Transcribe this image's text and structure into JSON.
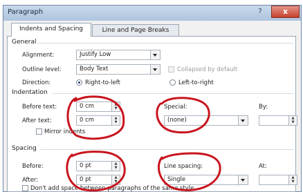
{
  "banner_text": "",
  "window": {
    "title": "Paragraph",
    "help_symbol": "?",
    "close_symbol": "x"
  },
  "tabs": [
    {
      "label": "Indents and Spacing"
    },
    {
      "label": "Line and Page Breaks"
    }
  ],
  "general": {
    "heading": "General",
    "alignment": {
      "label": "Alignment:",
      "value": "Justify Low"
    },
    "outline_level": {
      "label": "Outline level:",
      "value": "Body Text"
    },
    "collapsed": {
      "label": "Collapsed by default"
    },
    "direction": {
      "label": "Direction:",
      "rtl": "Right-to-left",
      "ltr": "Left-to-right",
      "selected": "rtl"
    }
  },
  "indentation": {
    "heading": "Indentation",
    "before": {
      "label": "Before text:",
      "value": "0 cm"
    },
    "after": {
      "label": "After text:",
      "value": "0 cm"
    },
    "special": {
      "label": "Special:",
      "value": "(none)"
    },
    "by": {
      "label": "By:",
      "value": ""
    },
    "mirror": {
      "label": "Mirror indents"
    }
  },
  "spacing": {
    "heading": "Spacing",
    "before": {
      "label": "Before:",
      "value": "0 pt"
    },
    "after": {
      "label": "After:",
      "value": "0 pt"
    },
    "line_spacing": {
      "label": "Line spacing:",
      "value": "Single"
    },
    "at": {
      "label": "At:",
      "value": ""
    },
    "dont_add": {
      "label": "Don't add space between paragraphs of the same style"
    }
  },
  "colors": {
    "annotation": "#c8141e",
    "accent": "#1d3c6a"
  }
}
